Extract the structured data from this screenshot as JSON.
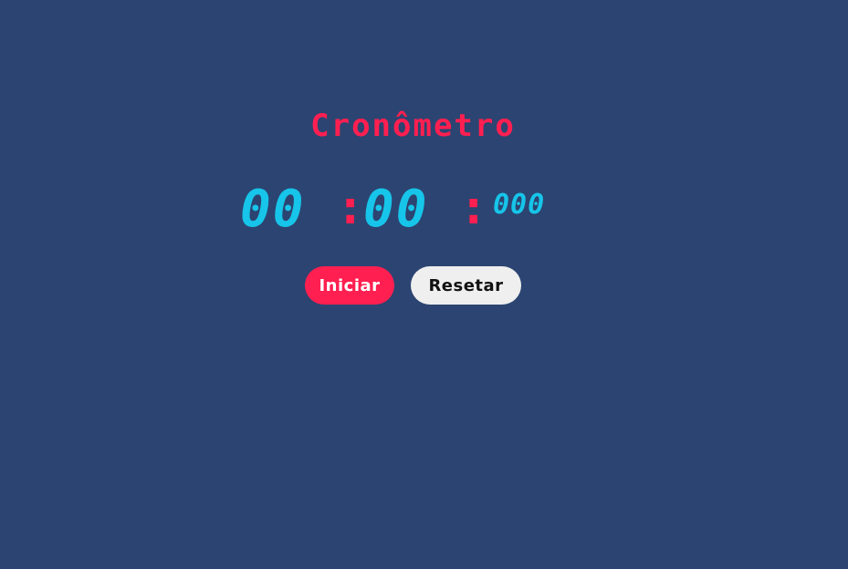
{
  "app": {
    "title": "Cronômetro"
  },
  "timer": {
    "minutes": "00",
    "seconds": "00",
    "milliseconds": "000",
    "separator": ":"
  },
  "controls": {
    "start_label": "Iniciar",
    "reset_label": "Resetar"
  },
  "colors": {
    "background": "#2c4471",
    "accent": "#ff1f50",
    "digits": "#16c5e9",
    "reset_button": "#efefef"
  }
}
